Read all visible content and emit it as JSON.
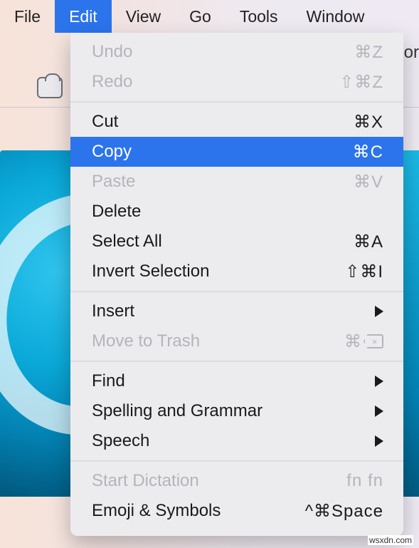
{
  "menubar": {
    "items": [
      {
        "label": "File",
        "active": false
      },
      {
        "label": "Edit",
        "active": true
      },
      {
        "label": "View",
        "active": false
      },
      {
        "label": "Go",
        "active": false
      },
      {
        "label": "Tools",
        "active": false
      },
      {
        "label": "Window",
        "active": false
      }
    ]
  },
  "fragment": "cor",
  "menu": {
    "title": "Edit",
    "groups": [
      {
        "items": [
          {
            "label": "Undo",
            "shortcut": "⌘Z",
            "disabled": true
          },
          {
            "label": "Redo",
            "shortcut": "⇧⌘Z",
            "disabled": true
          }
        ]
      },
      {
        "items": [
          {
            "label": "Cut",
            "shortcut": "⌘X"
          },
          {
            "label": "Copy",
            "shortcut": "⌘C",
            "highlighted": true
          },
          {
            "label": "Paste",
            "shortcut": "⌘V",
            "disabled": true
          },
          {
            "label": "Delete"
          },
          {
            "label": "Select All",
            "shortcut": "⌘A"
          },
          {
            "label": "Invert Selection",
            "shortcut": "⇧⌘I"
          }
        ]
      },
      {
        "items": [
          {
            "label": "Insert",
            "submenu": true
          },
          {
            "label": "Move to Trash",
            "shortcut_prefix": "⌘",
            "shortcut_glyph": "delete-key",
            "disabled": true
          }
        ]
      },
      {
        "items": [
          {
            "label": "Find",
            "submenu": true
          },
          {
            "label": "Spelling and Grammar",
            "submenu": true
          },
          {
            "label": "Speech",
            "submenu": true
          }
        ]
      },
      {
        "items": [
          {
            "label": "Start Dictation",
            "shortcut": "fn fn",
            "disabled": true
          },
          {
            "label": "Emoji & Symbols",
            "shortcut": "^⌘Space"
          }
        ]
      }
    ]
  },
  "watermark": "wsxdn.com",
  "colors": {
    "menu_highlight": "#2b74ec",
    "menu_bg": "#ececef",
    "disabled_text": "#b4b4bb",
    "artwork_blue": "#0aa9d8"
  }
}
